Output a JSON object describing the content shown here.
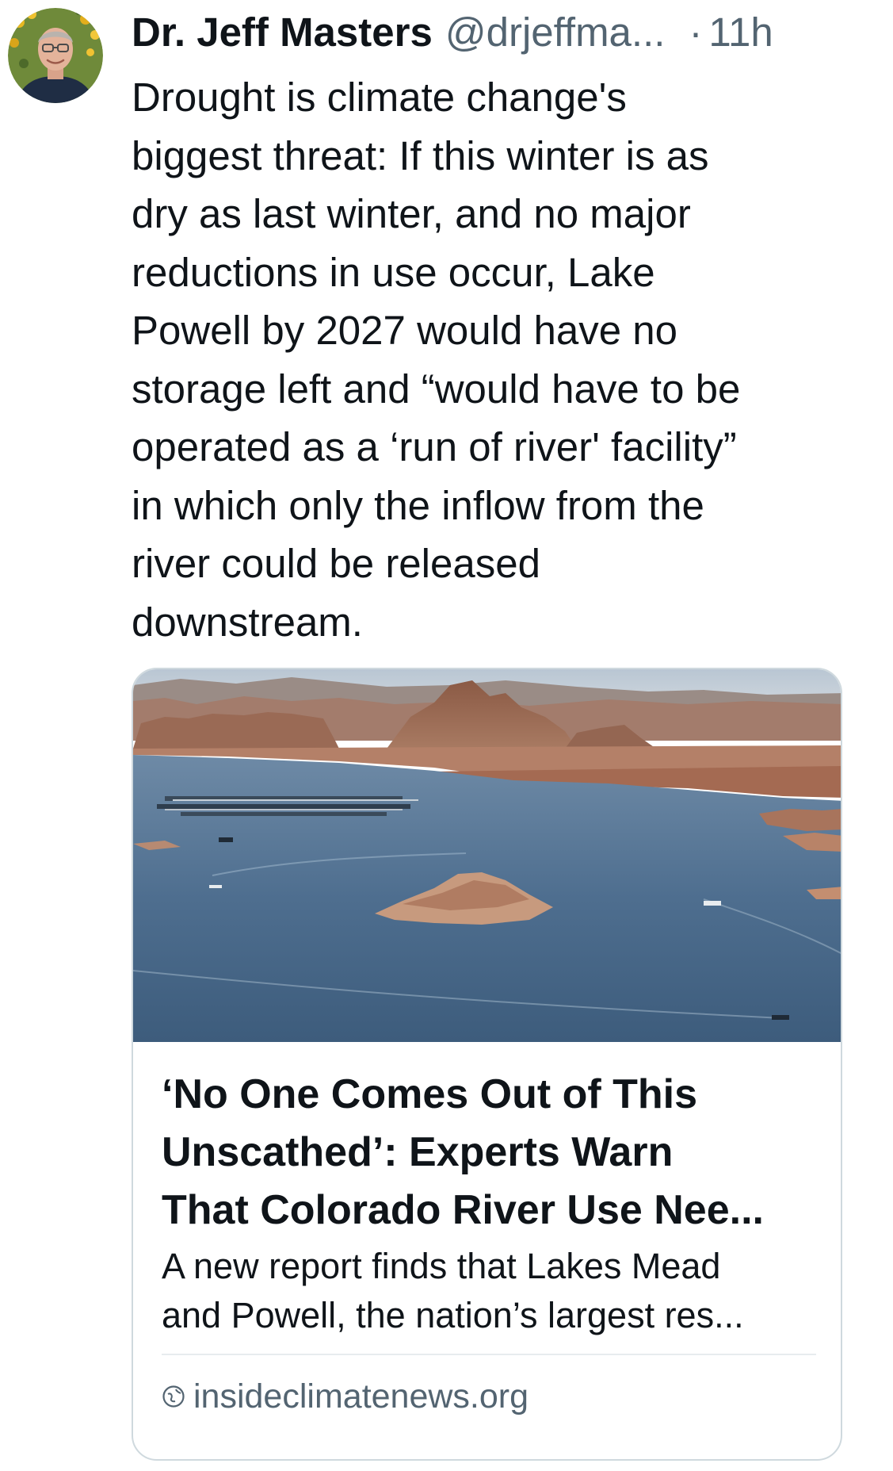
{
  "tweet": {
    "author_name": "Dr. Jeff Masters",
    "author_handle": "@drjeffma...",
    "separator": "·",
    "time": "11h",
    "text": "Drought is climate change's\nbiggest threat: If this winter is as\ndry as last winter, and no major\nreductions in use occur, Lake\nPowell by 2027 would have no\nstorage left and “would have to be\noperated as a ‘run of river' facility”\nin which only the inflow from the\nriver could be released\ndownstream."
  },
  "card": {
    "image_icon": "lake-powell-photo",
    "title": "‘No One Comes Out of This\nUnscathed’: Experts Warn\nThat Colorado River Use Nee...",
    "description": "A new report finds that Lakes Mead\nand Powell, the nation’s largest res...",
    "domain": "insideclimatenews.org",
    "domain_icon": "globe-icon"
  },
  "colors": {
    "text_primary": "#0f1419",
    "text_secondary": "#536471",
    "card_border": "#cfd9de",
    "divider": "#e7ecef"
  }
}
